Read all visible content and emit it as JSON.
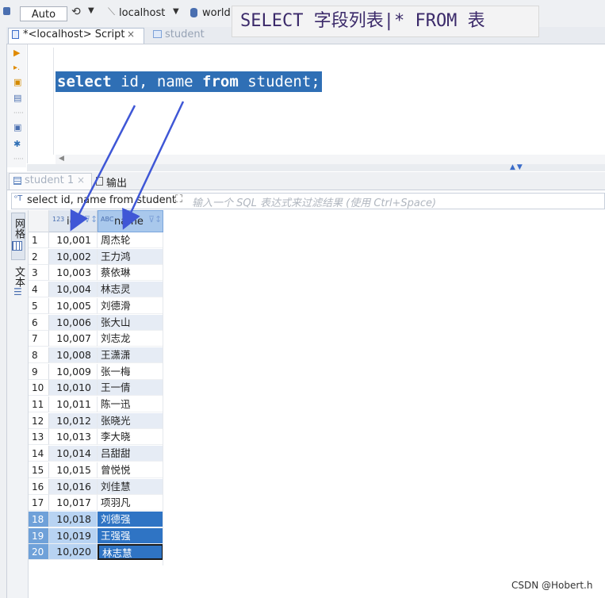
{
  "toolbar": {
    "mode": "Auto",
    "connection": "localhost",
    "database": "world"
  },
  "caption": "SELECT 字段列表|* FROM 表",
  "tabs": [
    {
      "label": "*<localhost> Script",
      "close": "×"
    },
    {
      "label": "student"
    }
  ],
  "editor": {
    "sql_keyword1": "select",
    "sql_mid": " id, name ",
    "sql_keyword2": "from",
    "sql_end": " student;"
  },
  "result_tabs": [
    {
      "label": "student 1",
      "close": "×"
    },
    {
      "label": "输出"
    }
  ],
  "filter": {
    "query": "select id, name from student",
    "placeholder": "输入一个 SQL 表达式来过滤结果 (使用 Ctrl+Space)"
  },
  "grid_side": {
    "grid_label": "网格",
    "text_label": "文本"
  },
  "columns": [
    {
      "type": "123",
      "label": "id"
    },
    {
      "type": "ABC",
      "label": "name"
    }
  ],
  "rows": [
    {
      "n": "1",
      "id": "10,001",
      "name": "周杰轮"
    },
    {
      "n": "2",
      "id": "10,002",
      "name": "王力鸿"
    },
    {
      "n": "3",
      "id": "10,003",
      "name": "蔡依琳"
    },
    {
      "n": "4",
      "id": "10,004",
      "name": "林志灵"
    },
    {
      "n": "5",
      "id": "10,005",
      "name": "刘德滑"
    },
    {
      "n": "6",
      "id": "10,006",
      "name": "张大山"
    },
    {
      "n": "7",
      "id": "10,007",
      "name": "刘志龙"
    },
    {
      "n": "8",
      "id": "10,008",
      "name": "王潇潇"
    },
    {
      "n": "9",
      "id": "10,009",
      "name": "张一梅"
    },
    {
      "n": "10",
      "id": "10,010",
      "name": "王一倩"
    },
    {
      "n": "11",
      "id": "10,011",
      "name": "陈一迅"
    },
    {
      "n": "12",
      "id": "10,012",
      "name": "张晓光"
    },
    {
      "n": "13",
      "id": "10,013",
      "name": "李大晓"
    },
    {
      "n": "14",
      "id": "10,014",
      "name": "吕甜甜"
    },
    {
      "n": "15",
      "id": "10,015",
      "name": "曾悦悦"
    },
    {
      "n": "16",
      "id": "10,016",
      "name": "刘佳慧"
    },
    {
      "n": "17",
      "id": "10,017",
      "name": "项羽凡"
    },
    {
      "n": "18",
      "id": "10,018",
      "name": "刘德强"
    },
    {
      "n": "19",
      "id": "10,019",
      "name": "王强强"
    },
    {
      "n": "20",
      "id": "10,020",
      "name": "林志慧"
    }
  ],
  "watermark": "CSDN @Hobert.h",
  "colors": {
    "selection": "#2f6fb5",
    "caption_text": "#3b2a6a",
    "arrow": "#3f57d6"
  }
}
